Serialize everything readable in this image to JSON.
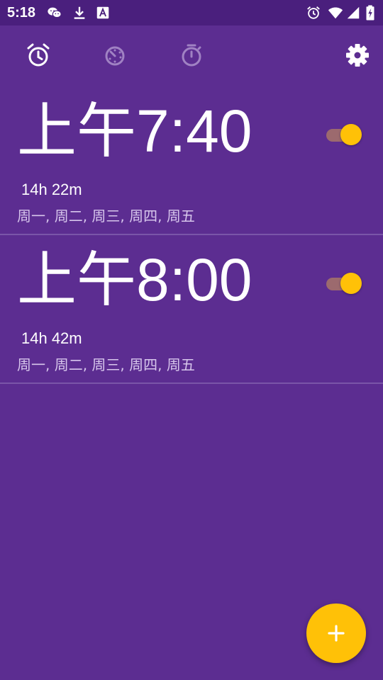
{
  "status_bar": {
    "time": "5:18",
    "left_icons": [
      "wechat-icon",
      "download-icon",
      "a-box-icon"
    ],
    "right_icons": [
      "alarm-status-icon",
      "wifi-icon",
      "signal-icon",
      "battery-charging-icon"
    ]
  },
  "toolbar": {
    "tabs": [
      {
        "name": "alarm",
        "icon": "alarm-clock-icon",
        "active": true
      },
      {
        "name": "clock",
        "icon": "clock-dial-icon",
        "active": false
      },
      {
        "name": "timer",
        "icon": "stopwatch-icon",
        "active": false
      }
    ],
    "settings_icon": "gear-icon"
  },
  "alarms": [
    {
      "ampm": "上午",
      "time": "7:40",
      "remaining": "14h 22m",
      "days": "周一, 周二, 周三, 周四, 周五",
      "enabled": true
    },
    {
      "ampm": "上午",
      "time": "8:00",
      "remaining": "14h 42m",
      "days": "周一, 周二, 周三, 周四, 周五",
      "enabled": true
    }
  ],
  "fab": {
    "icon": "plus-icon"
  },
  "colors": {
    "background": "#5c2d91",
    "status_bar": "#4a1f7d",
    "accent": "#ffc107",
    "toggle_track": "#9c6a6e",
    "divider": "#7a55a8",
    "secondary_text": "#d7c6ec"
  }
}
